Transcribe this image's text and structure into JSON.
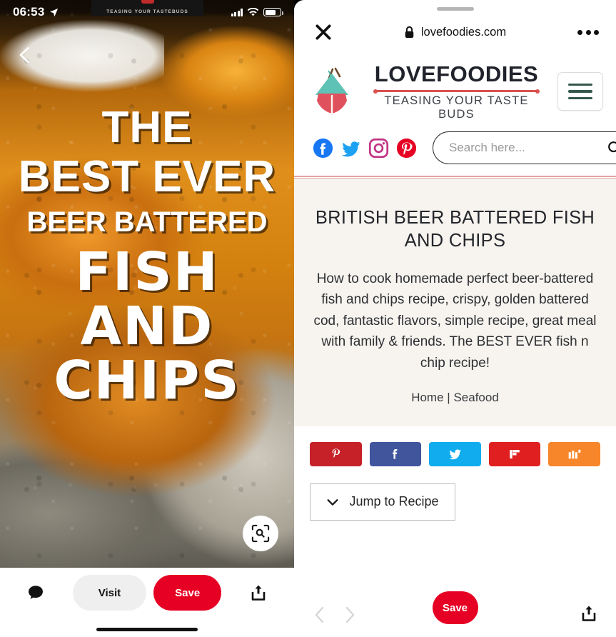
{
  "pin": {
    "status_bar": {
      "time": "06:53",
      "location_icon": "location-arrow-icon",
      "signal_icon": "cellular-signal-icon",
      "wifi_icon": "wifi-icon",
      "battery_icon": "battery-icon"
    },
    "back_icon": "back-chevron-icon",
    "banner_text": "TEASING YOUR TASTEBUDS",
    "overlay_title": {
      "line1": "THE",
      "line2": "BEST EVER",
      "line3": "BEER BATTERED",
      "line4": "FISH",
      "line5": "AND",
      "line6": "CHIPS"
    },
    "lens_icon": "visual-search-icon",
    "actions": {
      "comment_icon": "comment-bubble-icon",
      "visit_label": "Visit",
      "save_label": "Save",
      "share_icon": "share-icon"
    }
  },
  "browser": {
    "close_icon": "close-x-icon",
    "lock_icon": "lock-icon",
    "url": "lovefoodies.com",
    "menu_icon": "more-options-icon",
    "footer": {
      "back_icon": "chevron-left-icon",
      "forward_icon": "chevron-right-icon",
      "save_label": "Save",
      "share_icon": "share-icon"
    }
  },
  "site": {
    "logo_icon": "lovefoodies-logo-icon",
    "name": "LOVEFOODIES",
    "tagline": "TEASING YOUR TASTE BUDS",
    "menu_icon": "hamburger-menu-icon",
    "social": [
      {
        "name": "facebook-icon",
        "color": "#1877F2"
      },
      {
        "name": "twitter-icon",
        "color": "#1DA1F2"
      },
      {
        "name": "instagram-icon",
        "color": "#C13584"
      },
      {
        "name": "pinterest-icon",
        "color": "#E60023"
      }
    ],
    "search": {
      "placeholder": "Search here...",
      "value": "",
      "icon": "search-icon"
    }
  },
  "article": {
    "title": "BRITISH BEER BATTERED FISH AND CHIPS",
    "description": "How to cook homemade perfect beer-battered fish and chips recipe, crispy, golden battered cod, fantastic flavors, simple recipe, great meal with family & friends. The BEST EVER fish n chip recipe!",
    "breadcrumb_home": "Home",
    "breadcrumb_sep": "|",
    "breadcrumb_category": "Seafood",
    "background_color": "#f7f4ef"
  },
  "share_buttons": [
    {
      "name": "pinterest-share-button",
      "icon": "pinterest-icon",
      "color": "#c62128"
    },
    {
      "name": "facebook-share-button",
      "icon": "facebook-icon",
      "color": "#41559d"
    },
    {
      "name": "twitter-share-button",
      "icon": "twitter-icon",
      "color": "#10aced"
    },
    {
      "name": "flipboard-share-button",
      "icon": "flipboard-icon",
      "color": "#e02020"
    },
    {
      "name": "mix-share-button",
      "icon": "mix-icon",
      "color": "#f7862a"
    }
  ],
  "jump": {
    "label": "Jump to Recipe",
    "icon": "chevron-down-icon"
  }
}
